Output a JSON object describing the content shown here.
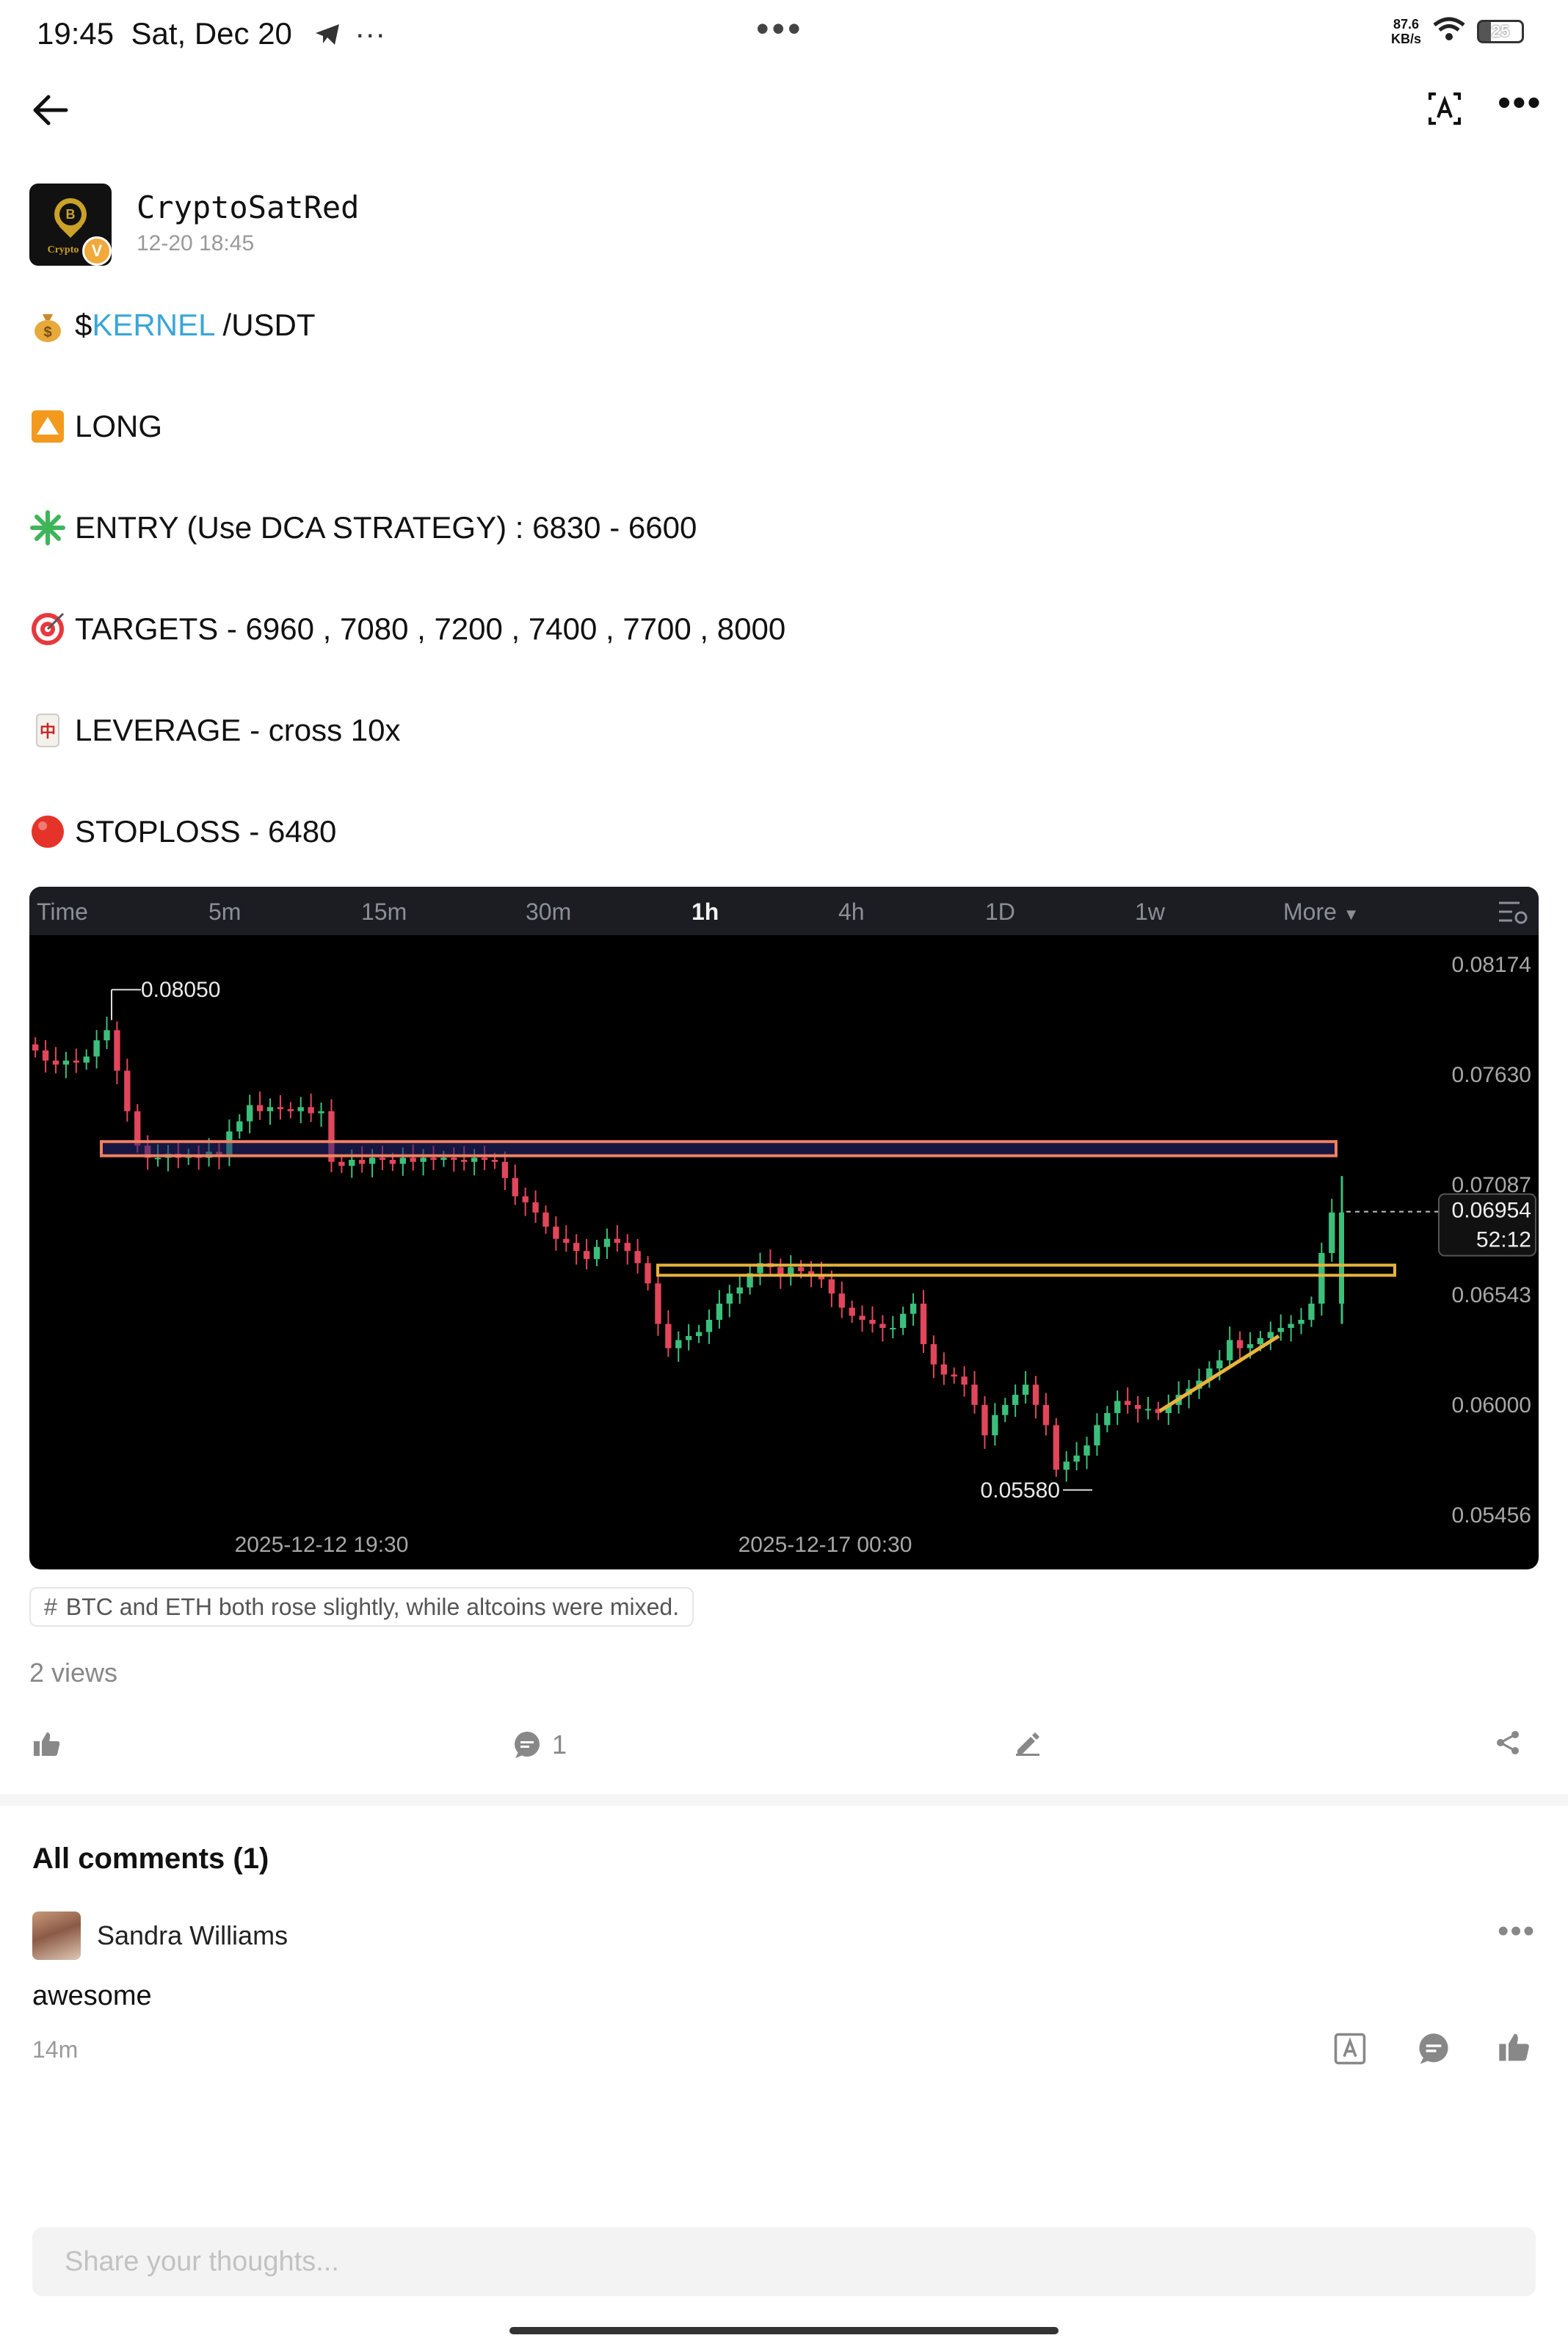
{
  "status_bar": {
    "time": "19:45",
    "date": "Sat, Dec 20",
    "net_speed_value": "87.6",
    "net_speed_unit": "KB/s",
    "battery": "25"
  },
  "post": {
    "author": "CryptoSatRed",
    "timestamp": "12-20 18:45",
    "avatar_label": "Crypto",
    "lines": {
      "pair_prefix": "$",
      "pair_cashtag": "KERNEL",
      "pair_suffix": " /USDT",
      "direction": "LONG",
      "entry": "ENTRY (Use DCA STRATEGY) : 6830 - 6600",
      "targets": "TARGETS - 6960 , 7080 , 7200 , 7400 , 7700 , 8000",
      "leverage": "LEVERAGE -  cross 10x",
      "stoploss": "STOPLOSS - 6480"
    },
    "topic_tag": "BTC and ETH both rose slightly, while altcoins were mixed.",
    "views": "2 views",
    "comment_count": "1"
  },
  "chart_tabs": [
    "Time",
    "5m",
    "15m",
    "30m",
    "1h",
    "4h",
    "1D",
    "1w",
    "More"
  ],
  "chart_active_tab": "1h",
  "chart_data": {
    "type": "candlestick",
    "y_tick_labels": [
      "0.08174",
      "0.07630",
      "0.07087",
      "0.06543",
      "0.06000",
      "0.05456"
    ],
    "ylim": [
      0.05456,
      0.08174
    ],
    "x_tick_labels": [
      "2025-12-12 19:30",
      "2025-12-17 00:30"
    ],
    "high_label": "0.08050",
    "low_label": "0.05580",
    "current_price": "0.06954",
    "countdown": "52:12",
    "close_trend": [
      0.0775,
      0.077,
      0.0768,
      0.077,
      0.0769,
      0.0772,
      0.078,
      0.0785,
      0.0765,
      0.0745,
      0.0728,
      0.0722,
      0.0722,
      0.0724,
      0.0722,
      0.0723,
      0.0722,
      0.0725,
      0.0723,
      0.0735,
      0.074,
      0.0748,
      0.0745,
      0.0747,
      0.0746,
      0.0745,
      0.0747,
      0.0744,
      0.0745,
      0.072,
      0.0718,
      0.0721,
      0.0719,
      0.0722,
      0.0721,
      0.0719,
      0.0722,
      0.072,
      0.0722,
      0.0721,
      0.0722,
      0.0721,
      0.072,
      0.0722,
      0.0721,
      0.072,
      0.0712,
      0.0703,
      0.07,
      0.0695,
      0.0688,
      0.0682,
      0.068,
      0.0676,
      0.0672,
      0.0678,
      0.0682,
      0.068,
      0.0676,
      0.067,
      0.066,
      0.064,
      0.0628,
      0.0632,
      0.0634,
      0.0636,
      0.0642,
      0.065,
      0.0655,
      0.0658,
      0.0665,
      0.067,
      0.0668,
      0.0664,
      0.0668,
      0.0666,
      0.0664,
      0.0662,
      0.0655,
      0.0648,
      0.0644,
      0.0642,
      0.064,
      0.0638,
      0.0638,
      0.0645,
      0.065,
      0.063,
      0.062,
      0.0615,
      0.0614,
      0.061,
      0.06,
      0.0585,
      0.0595,
      0.06,
      0.0605,
      0.061,
      0.06,
      0.059,
      0.0568,
      0.0572,
      0.0575,
      0.058,
      0.059,
      0.0596,
      0.0602,
      0.06,
      0.0598,
      0.0598,
      0.0596,
      0.06,
      0.0605,
      0.0608,
      0.0612,
      0.0618,
      0.0622,
      0.0632,
      0.0628,
      0.063,
      0.0633,
      0.0636,
      0.0638,
      0.064,
      0.0642,
      0.065,
      0.0675,
      0.0695
    ]
  },
  "actions": {
    "like": "like",
    "comment": "1",
    "edit": "edit",
    "share": "share"
  },
  "comments": {
    "title": "All comments (1)",
    "items": [
      {
        "author": "Sandra Williams",
        "text": "awesome",
        "time": "14m"
      }
    ]
  },
  "composer": {
    "placeholder": "Share your thoughts..."
  }
}
